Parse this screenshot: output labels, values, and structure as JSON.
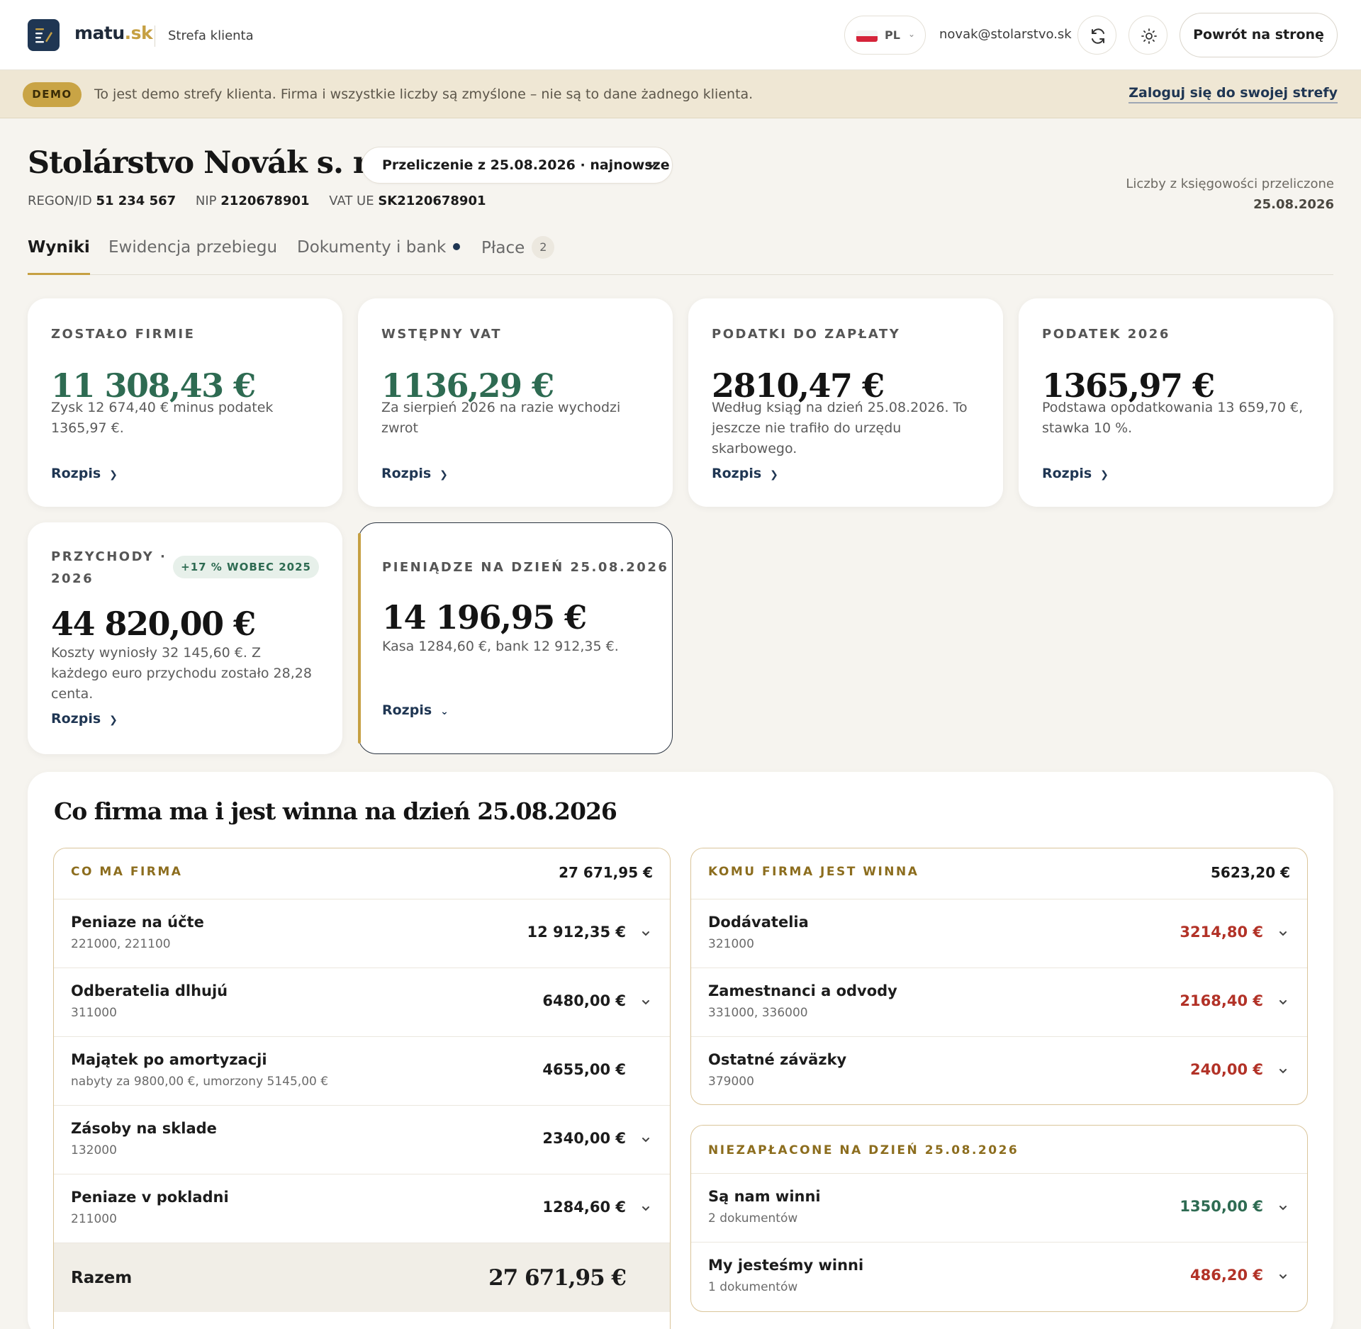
{
  "header": {
    "brand_main": "matu",
    "brand_tld": ".sk",
    "zone": "Strefa klienta",
    "lang": "PL",
    "email": "novak@stolarstvo.sk",
    "back_label": "Powrót na stronę"
  },
  "banner": {
    "badge": "DEMO",
    "text": "To jest demo strefy klienta. Firma i wszystkie liczby są zmyślone – nie są to dane żadnego klienta.",
    "link": "Zaloguj się do swojej strefy"
  },
  "company": {
    "name": "Stolárstvo Novák s. r. o.",
    "recalc": "Przeliczenie z 25.08.2026 · najnowsze",
    "regon_label": "REGON/ID",
    "regon": "51 234 567",
    "nip_label": "NIP",
    "nip": "2120678901",
    "vat_label": "VAT UE",
    "vat": "SK2120678901",
    "note_line1": "Liczby z księgowości przeliczone",
    "note_date": "25.08.2026"
  },
  "tabs": [
    {
      "label": "Wyniki"
    },
    {
      "label": "Ewidencja przebiegu"
    },
    {
      "label": "Dokumenty i bank"
    },
    {
      "label": "Płace",
      "count": "2"
    }
  ],
  "cards": [
    {
      "label": "ZOSTAŁO FIRMIE",
      "value": "11 308,43 €",
      "desc": "Zysk 12 674,40 € minus podatek 1365,97 €.",
      "link": "Rozpis"
    },
    {
      "label": "WSTĘPNY VAT",
      "value": "1136,29 €",
      "desc": "Za sierpień 2026 na razie wychodzi zwrot",
      "link": "Rozpis"
    },
    {
      "label": "PODATKI DO ZAPŁATY",
      "value": "2810,47 €",
      "desc": "Według ksiąg na dzień 25.08.2026. To jeszcze nie trafiło do urzędu skarbowego.",
      "link": "Rozpis"
    },
    {
      "label": "PODATEK 2026",
      "value": "1365,97 €",
      "desc": "Podstawa opodatkowania 13 659,70 €, stawka 10 %.",
      "link": "Rozpis"
    },
    {
      "label": "PRZYCHODY · 2026",
      "badge": "+17 % WOBEC 2025",
      "value": "44 820,00 €",
      "desc": "Koszty wyniosły 32 145,60 €. Z każdego euro przychodu zostało 28,28 centa.",
      "link": "Rozpis"
    },
    {
      "label": "PIENIĄDZE NA DZIEŃ 25.08.2026",
      "value": "14 196,95 €",
      "desc": "Kasa 1284,60 €, bank 12 912,35 €.",
      "link": "Rozpis"
    }
  ],
  "balance": {
    "title": "Co firma ma i jest winna na dzień 25.08.2026",
    "assets": {
      "label": "CO MA FIRMA",
      "total": "27 671,95 €",
      "rows": [
        {
          "name": "Peniaze na účte",
          "sub": "221000, 221100",
          "amount": "12 912,35 €"
        },
        {
          "name": "Odberatelia dlhujú",
          "sub": "311000",
          "amount": "6480,00 €"
        },
        {
          "name": "Majątek po amortyzacji",
          "sub": "nabyty za 9800,00 €, umorzony 5145,00 €",
          "amount": "4655,00 €"
        },
        {
          "name": "Zásoby na sklade",
          "sub": "132000",
          "amount": "2340,00 €"
        },
        {
          "name": "Peniaze v pokladni",
          "sub": "211000",
          "amount": "1284,60 €"
        }
      ],
      "sum_label": "Razem",
      "sum_value": "27 671,95 €"
    },
    "liabilities": {
      "label": "KOMU FIRMA JEST WINNA",
      "total": "5623,20 €",
      "rows": [
        {
          "name": "Dodávatelia",
          "sub": "321000",
          "amount": "3214,80 €"
        },
        {
          "name": "Zamestnanci a odvody",
          "sub": "331000, 336000",
          "amount": "2168,40 €"
        },
        {
          "name": "Ostatné záväzky",
          "sub": "379000",
          "amount": "240,00 €"
        }
      ]
    },
    "unpaid": {
      "label": "NIEZAPŁACONE NA DZIEŃ 25.08.2026",
      "rows": [
        {
          "name": "Są nam winni",
          "sub": "2 dokumentów",
          "amount": "1350,00 €"
        },
        {
          "name": "My jesteśmy winni",
          "sub": "1 dokumentów",
          "amount": "486,20 €"
        }
      ]
    }
  },
  "colors": {
    "accent_gold": "#c6a043",
    "navy": "#1f3653",
    "positive_green": "#2e6b52",
    "negative_red": "#b23227"
  }
}
